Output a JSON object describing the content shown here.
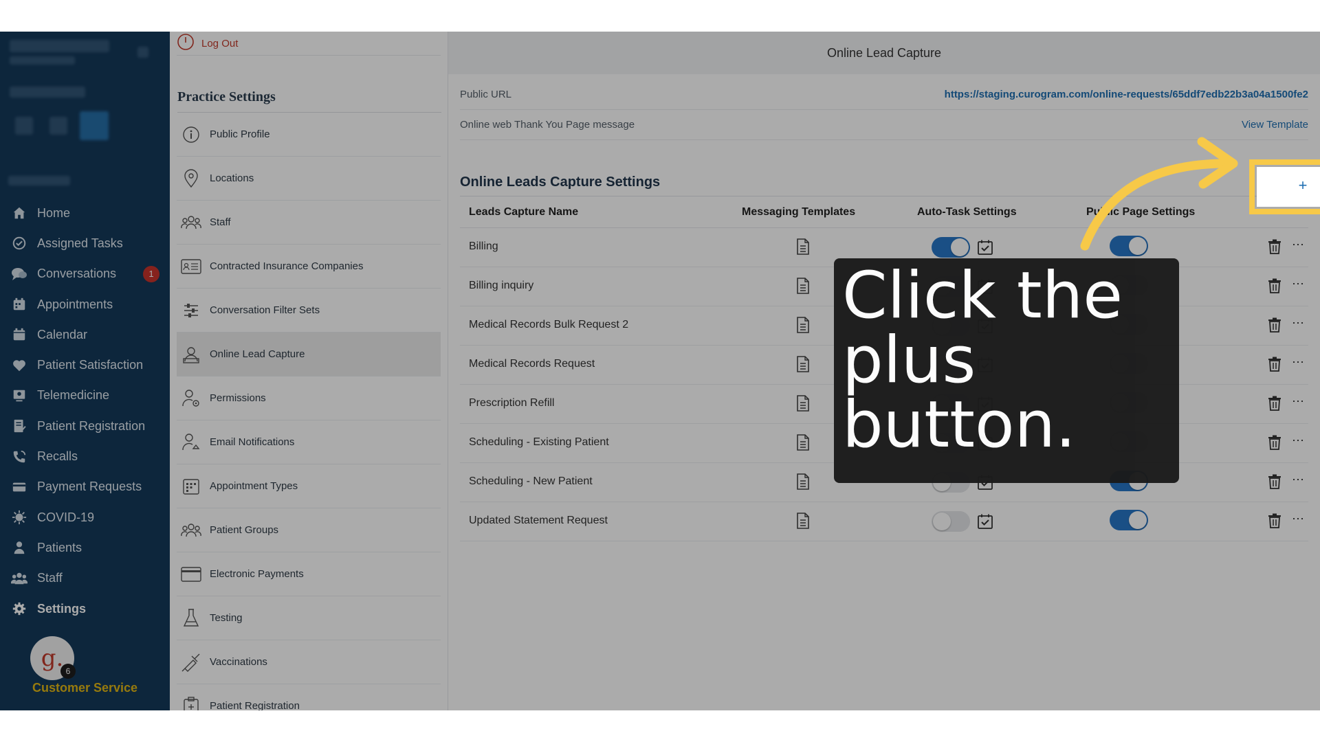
{
  "sidebar": {
    "items": [
      {
        "label": "Home",
        "icon": "home-icon"
      },
      {
        "label": "Assigned Tasks",
        "icon": "check-circle-icon"
      },
      {
        "label": "Conversations",
        "icon": "chat-icon",
        "badge": "1"
      },
      {
        "label": "Appointments",
        "icon": "appointments-icon"
      },
      {
        "label": "Calendar",
        "icon": "calendar-icon"
      },
      {
        "label": "Patient Satisfaction",
        "icon": "heart-icon"
      },
      {
        "label": "Telemedicine",
        "icon": "telemedicine-icon"
      },
      {
        "label": "Patient Registration",
        "icon": "registration-icon"
      },
      {
        "label": "Recalls",
        "icon": "phone-recall-icon"
      },
      {
        "label": "Payment Requests",
        "icon": "credit-card-icon"
      },
      {
        "label": "COVID-19",
        "icon": "virus-icon"
      },
      {
        "label": "Patients",
        "icon": "person-icon"
      },
      {
        "label": "Staff",
        "icon": "group-icon"
      },
      {
        "label": "Settings",
        "icon": "gear-icon"
      }
    ],
    "avatar_letter": "g.",
    "avatar_badge": "6",
    "footer_label": "Customer Service"
  },
  "settings": {
    "logout": "Log Out",
    "title": "Practice Settings",
    "items": [
      "Public Profile",
      "Locations",
      "Staff",
      "Contracted Insurance Companies",
      "Conversation Filter Sets",
      "Online Lead Capture",
      "Permissions",
      "Email Notifications",
      "Appointment Types",
      "Patient Groups",
      "Electronic Payments",
      "Testing",
      "Vaccinations",
      "Patient Registration"
    ]
  },
  "main": {
    "header": "Online Lead Capture",
    "public_url_label": "Public URL",
    "public_url": "https://staging.curogram.com/online-requests/65ddf7edb22b3a04a1500fe2",
    "thankyou_label": "Online web Thank You Page message",
    "view_template": "View Template",
    "section_title": "Online Leads Capture Settings",
    "plus": "+",
    "columns": [
      "Leads Capture Name",
      "Messaging Templates",
      "Auto-Task Settings",
      "Public Page Settings"
    ],
    "rows": [
      {
        "name": "Billing",
        "auto_task": true,
        "public_page": true
      },
      {
        "name": "Billing inquiry",
        "auto_task": false,
        "public_page": false
      },
      {
        "name": "Medical Records Bulk Request 2",
        "auto_task": false,
        "public_page": false
      },
      {
        "name": "Medical Records Request",
        "auto_task": false,
        "public_page": false
      },
      {
        "name": "Prescription Refill",
        "auto_task": false,
        "public_page": false
      },
      {
        "name": "Scheduling - Existing Patient",
        "auto_task": false,
        "public_page": false
      },
      {
        "name": "Scheduling - New Patient",
        "auto_task": false,
        "public_page": true
      },
      {
        "name": "Updated Statement Request",
        "auto_task": false,
        "public_page": true
      }
    ]
  },
  "callout": {
    "text": "Click the plus button."
  },
  "colors": {
    "sidebar_bg": "#14395a",
    "accent_blue": "#2877c7",
    "link_blue": "#1f6fb2",
    "highlight_yellow": "#f7c948",
    "badge_red": "#c8342c",
    "footer_gold": "#e2b714"
  }
}
